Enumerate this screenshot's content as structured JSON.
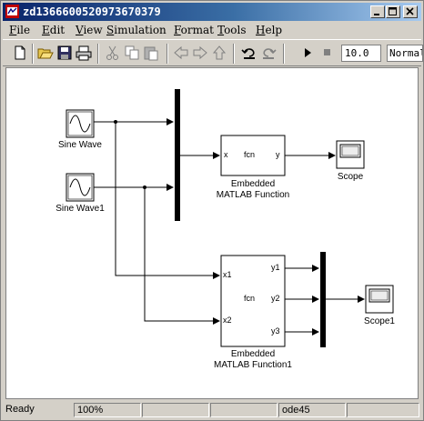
{
  "window": {
    "title": "zd1366600520973670379"
  },
  "menu": {
    "items": [
      "File",
      "Edit",
      "View",
      "Simulation",
      "Format",
      "Tools",
      "Help"
    ]
  },
  "toolbar": {
    "stop_time": "10.0",
    "sim_mode": "Normal"
  },
  "blocks": {
    "sine1": {
      "label": "Sine Wave"
    },
    "sine2": {
      "label": "Sine Wave1"
    },
    "fcn1": {
      "text": "fcn",
      "in_port": "x",
      "out_port": "y",
      "label_line1": "Embedded",
      "label_line2": "MATLAB Function"
    },
    "fcn2": {
      "text": "fcn",
      "in1": "x1",
      "in2": "x2",
      "out1": "y1",
      "out2": "y2",
      "out3": "y3",
      "label_line1": "Embedded",
      "label_line2": "MATLAB Function1"
    },
    "scope1": {
      "label": "Scope"
    },
    "scope2": {
      "label": "Scope1"
    }
  },
  "status": {
    "state": "Ready",
    "zoom": "100%",
    "cell3": "",
    "cell4": "",
    "solver": "ode45",
    "cell6": ""
  }
}
